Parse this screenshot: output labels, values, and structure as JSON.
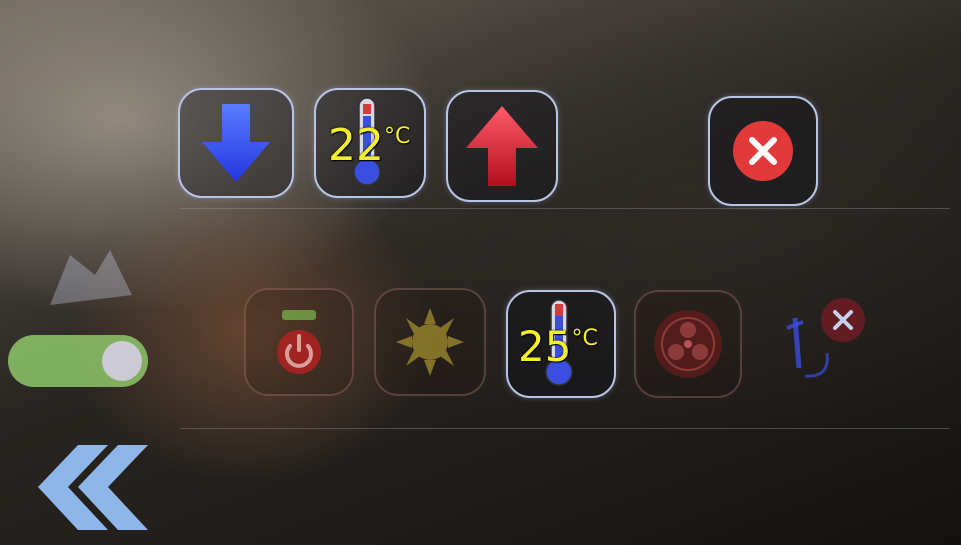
{
  "setpoint": {
    "value": "22",
    "unit": "°C",
    "down_icon": "arrow-down-icon",
    "up_icon": "arrow-up-icon"
  },
  "close_icon": "close-icon",
  "controls": {
    "power_icon": "power-icon",
    "mode_icon": "sun-icon",
    "fan_icon": "fan-icon",
    "swing_icon": "swing-icon"
  },
  "room_temperature": {
    "value": "25",
    "unit": "°C"
  },
  "toggle": {
    "state": "on"
  },
  "back_icon": "double-chevron-left-icon",
  "colors": {
    "button_border": "#b8c4e4",
    "temperature_text": "#f4ef2a",
    "down_arrow": "#3a5cff",
    "up_arrow": "#e0283a",
    "close_red": "#e23a3a",
    "toggle_green": "#8fc66a",
    "back_blue": "#8fb6e8"
  }
}
